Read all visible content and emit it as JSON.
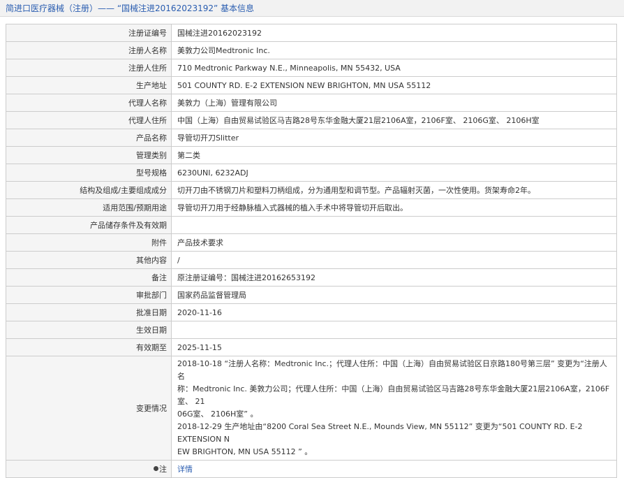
{
  "header": {
    "title": "简进口医疗器械（注册）—— “国械注进20162023192” 基本信息",
    "accent_color": "#2a5db0"
  },
  "rows": [
    {
      "label": "注册证编号",
      "value": "国械注进20162023192"
    },
    {
      "label": "注册人名称",
      "value": "美敦力公司Medtronic Inc."
    },
    {
      "label": "注册人住所",
      "value": "710 Medtronic Parkway N.E., Minneapolis, MN 55432, USA"
    },
    {
      "label": "生产地址",
      "value": "501 COUNTY RD. E-2 EXTENSION NEW BRIGHTON, MN USA 55112"
    },
    {
      "label": "代理人名称",
      "value": "美敦力（上海）管理有限公司"
    },
    {
      "label": "代理人住所",
      "value": "中国（上海）自由贸易试验区马吉路28号东华金融大厦21层2106A室，2106F室、 2106G室、 2106H室"
    },
    {
      "label": "产品名称",
      "value": "导管切开刀Slitter"
    },
    {
      "label": "管理类别",
      "value": "第二类"
    },
    {
      "label": "型号规格",
      "value": "6230UNI, 6232ADJ"
    },
    {
      "label": "结构及组成/主要组成成分",
      "value": "切开刀由不锈钢刀片和塑料刀柄组成，分为通用型和调节型。产品辐射灭菌，一次性使用。货架寿命2年。"
    },
    {
      "label": "适用范围/预期用途",
      "value": "导管切开刀用于经静脉植入式器械的植入手术中将导管切开后取出。"
    },
    {
      "label": "产品储存条件及有效期",
      "value": ""
    },
    {
      "label": "附件",
      "value": "产品技术要求"
    },
    {
      "label": "其他内容",
      "value": "/"
    },
    {
      "label": "备注",
      "value": "原注册证编号：国械注进20162653192"
    },
    {
      "label": "审批部门",
      "value": "国家药品监督管理局"
    },
    {
      "label": "批准日期",
      "value": "2020-11-16"
    },
    {
      "label": "生效日期",
      "value": ""
    },
    {
      "label": "有效期至",
      "value": "2025-11-15"
    }
  ],
  "changes": {
    "label": "变更情况",
    "lines": [
      "2018-10-18 “注册人名称：Medtronic Inc.；代理人住所：中国（上海）自由贸易试验区日京路180号第三层” 变更为“注册人名",
      "称：Medtronic Inc. 美敦力公司；代理人住所：中国（上海）自由贸易试验区马吉路28号东华金融大厦21层2106A室，2106F室、 21",
      "06G室、 2106H室” 。",
      "2018-12-29 生产地址由“8200 Coral Sea Street N.E., Mounds View, MN 55112” 变更为“501 COUNTY RD. E-2 EXTENSION N",
      "EW BRIGHTON, MN USA 55112 ” 。"
    ]
  },
  "note": {
    "label": "注",
    "link_text": "详情",
    "icon": "pin-icon"
  }
}
